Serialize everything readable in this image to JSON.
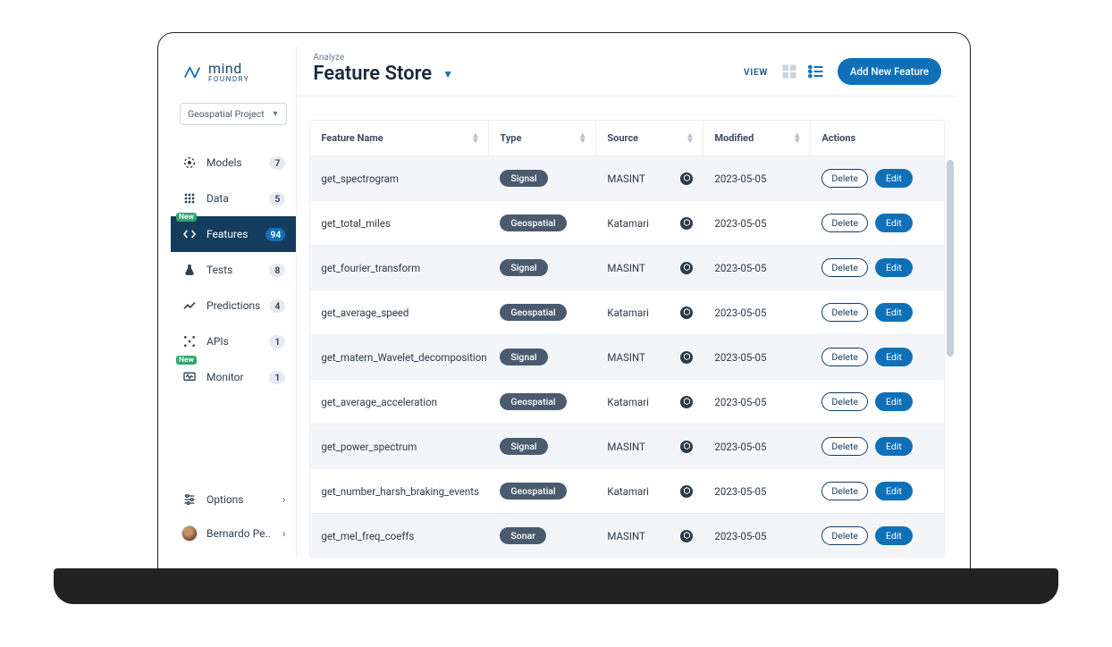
{
  "brand": {
    "line1": "mind",
    "line2": "FOUNDRY"
  },
  "project_selector": {
    "label": "Geospatial Project"
  },
  "nav": {
    "items": [
      {
        "label": "Models",
        "count": "7",
        "icon": "models-icon",
        "badge": null
      },
      {
        "label": "Data",
        "count": "5",
        "icon": "data-icon",
        "badge": null
      },
      {
        "label": "Features",
        "count": "94",
        "icon": "features-icon",
        "badge": "New",
        "active": true
      },
      {
        "label": "Tests",
        "count": "8",
        "icon": "tests-icon",
        "badge": null
      },
      {
        "label": "Predictions",
        "count": "4",
        "icon": "predictions-icon",
        "badge": null
      },
      {
        "label": "APIs",
        "count": "1",
        "icon": "apis-icon",
        "badge": null
      },
      {
        "label": "Monitor",
        "count": "1",
        "icon": "monitor-icon",
        "badge": "New"
      }
    ]
  },
  "sidebar_bottom": {
    "options": "Options",
    "user": "Bernardo Pe.."
  },
  "topbar": {
    "crumb": "Analyze",
    "title": "Feature Store",
    "view_label": "VIEW",
    "add_button": "Add New Feature"
  },
  "table": {
    "columns": [
      "Feature Name",
      "Type",
      "Source",
      "Modified",
      "Actions"
    ],
    "delete_label": "Delete",
    "edit_label": "Edit",
    "rows": [
      {
        "name": "get_spectrogram",
        "type": "Signal",
        "source": "MASINT",
        "modified": "2023-05-05"
      },
      {
        "name": "get_total_miles",
        "type": "Geospatial",
        "source": "Katamari",
        "modified": "2023-05-05"
      },
      {
        "name": "get_fourier_transform",
        "type": "Signal",
        "source": "MASINT",
        "modified": "2023-05-05"
      },
      {
        "name": "get_average_speed",
        "type": "Geospatial",
        "source": "Katamari",
        "modified": "2023-05-05"
      },
      {
        "name": "get_matern_Wavelet_decomposition",
        "type": "Signal",
        "source": "MASINT",
        "modified": "2023-05-05"
      },
      {
        "name": "get_average_acceleration",
        "type": "Geospatial",
        "source": "Katamari",
        "modified": "2023-05-05"
      },
      {
        "name": "get_power_spectrum",
        "type": "Signal",
        "source": "MASINT",
        "modified": "2023-05-05"
      },
      {
        "name": "get_number_harsh_braking_events",
        "type": "Geospatial",
        "source": "Katamari",
        "modified": "2023-05-05"
      },
      {
        "name": "get_mel_freq_coeffs",
        "type": "Sonar",
        "source": "MASINT",
        "modified": "2023-05-05"
      }
    ]
  }
}
